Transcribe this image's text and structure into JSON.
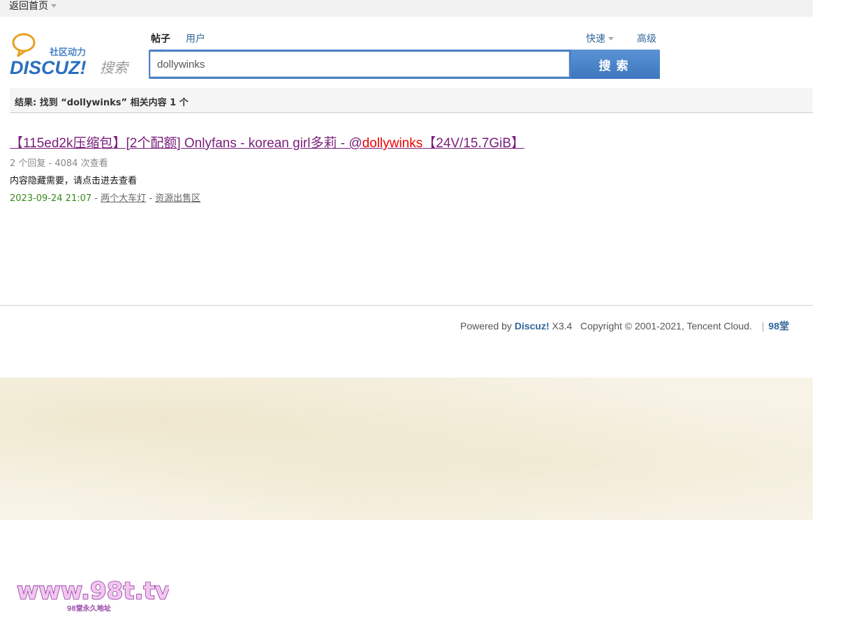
{
  "topbar": {
    "back_home": "返回首页"
  },
  "logo": {
    "tagline": "社区动力",
    "brand": "DISCUZ!",
    "suffix": "搜索"
  },
  "search": {
    "tabs": [
      {
        "label": "帖子",
        "active": true
      },
      {
        "label": "用户",
        "active": false
      }
    ],
    "quick_label": "快速",
    "advanced_label": "高级",
    "query": "dollywinks",
    "button_label": "搜索"
  },
  "results": {
    "summary": "结果: 找到 “dollywinks” 相关内容 1 个",
    "items": [
      {
        "title_prefix": "【115ed2k压缩包】[2个配额] Onlyfans - korean girl多莉 - @",
        "title_highlight": "dollywinks",
        "title_suffix": "【24V/15.7GiB】",
        "stats": "2 个回复 - 4084 次查看",
        "description": "内容隐藏需要，请点击进去查看",
        "date": "2023-09-24 21:07",
        "author": "两个大车灯",
        "forum": "资源出售区"
      }
    ]
  },
  "footer": {
    "powered_by": "Powered by",
    "brand": "Discuz!",
    "version": "X3.4",
    "copyright": "Copyright © 2001-2021, Tencent Cloud.",
    "site": "98堂"
  },
  "watermark": {
    "url": "www.98t.tv",
    "subtitle": "98堂永久地址"
  },
  "colors": {
    "accent": "#4a82c8",
    "link": "#336699",
    "visited_title": "#7a1e7a",
    "highlight": "#e00000",
    "date": "#3a8a1a"
  }
}
